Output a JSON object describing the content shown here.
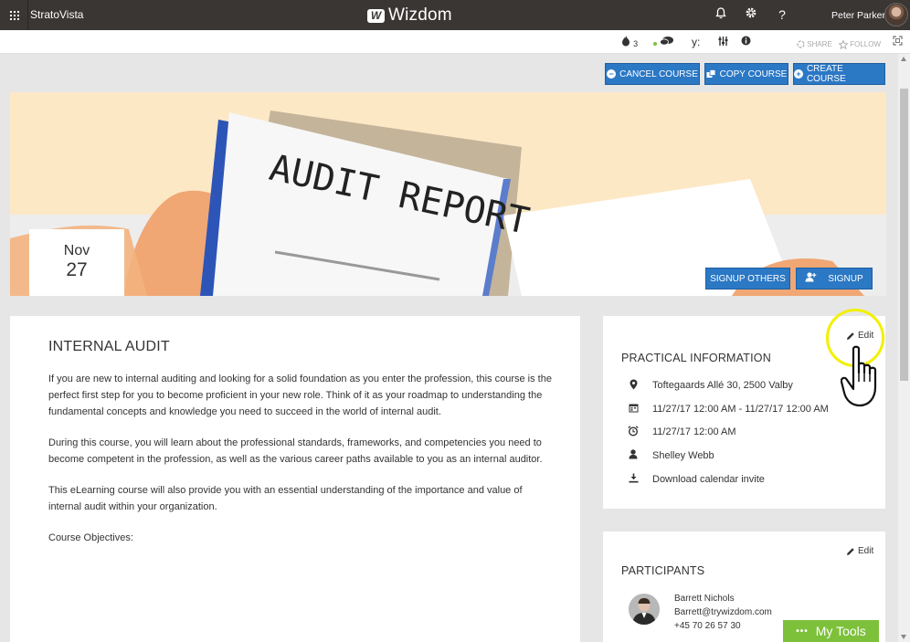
{
  "topbar": {
    "site_name": "StratoVista",
    "brand": "Wizdom",
    "brand_mark": "W",
    "user_name": "Peter Parker",
    "icons": [
      "waffle-icon",
      "bell-icon",
      "gear-icon",
      "help-icon"
    ],
    "help_glyph": "?"
  },
  "toolbar2": {
    "likes_count": "3",
    "share_label": "SHARE",
    "follow_label": "FOLLOW",
    "yammer_glyph": "y:"
  },
  "actions": {
    "cancel_course": "CANCEL COURSE",
    "copy_course": "COPY COURSE",
    "create_course": "CREATE COURSE"
  },
  "hero": {
    "date_month": "Nov",
    "date_day": "27",
    "signup_others": "SIGNUP OTHERS",
    "signup": "SIGNUP",
    "report_text": "AUDIT REPORT"
  },
  "course": {
    "title": "INTERNAL AUDIT",
    "paragraphs": [
      "If you are new to internal auditing and looking for a solid foundation as you enter the profession, this course is the perfect first step for you to become proficient in your new role. Think of it as your roadmap to understanding the fundamental concepts and knowledge you need to succeed in the world of internal audit.",
      "During this course, you will learn about the professional standards, frameworks, and competencies you need to become competent in the profession, as well as the various career paths available to you as an internal auditor.",
      "This eLearning course will also provide you with an essential understanding of the importance and value of internal audit within your organization.",
      "Course Objectives:"
    ]
  },
  "practical": {
    "title": "PRACTICAL INFORMATION",
    "edit_label": "Edit",
    "address": "Toftegaards Allé 30, 2500 Valby",
    "date_range": "11/27/17 12:00 AM - 11/27/17 12:00 AM",
    "reminder": "11/27/17 12:00 AM",
    "instructor": "Shelley Webb",
    "download": "Download calendar invite"
  },
  "participants": {
    "title": "PARTICIPANTS",
    "edit_label": "Edit",
    "items": [
      {
        "name": "Barrett Nichols",
        "email": "Barrett@trywizdom.com",
        "phone": "+45 70 26 57 30"
      }
    ]
  },
  "mytools": {
    "label": "My Tools",
    "glyph": "•••"
  },
  "colors": {
    "topbar": "#3a3634",
    "primary": "#2b78c5",
    "mytools": "#7dc13a",
    "highlight": "#f2f000"
  }
}
